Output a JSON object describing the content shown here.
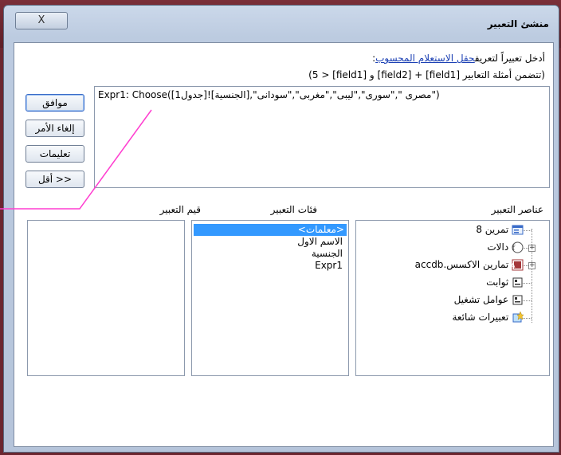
{
  "window": {
    "title": "منشئ التعبير",
    "close_label": "X"
  },
  "instructions": {
    "line1_prefix": "أدخل تعبيراً لتعريف",
    "line1_link": "حقل الاستعلام المحسوب",
    "line1_suffix": ":",
    "line2": "(تتضمن أمثلة التعابير [field1] + [field2] و [field1] < 5)"
  },
  "expression": {
    "value": "Expr1: Choose([جدول1]![الجنسية],\"مصرى \",\"سورى\",\"ليبى\",\"مغربى\",\"سودانى\")"
  },
  "buttons": {
    "ok": "موافق",
    "cancel": "إلغاء الأمر",
    "help": "تعليمات",
    "less": "<< أقل"
  },
  "sections": {
    "elements_label": "عناصر التعبير",
    "categories_label": "فئات التعبير",
    "values_label": "قيم التعبير"
  },
  "elements": [
    {
      "label": "تمرين 8",
      "icon": "form-icon"
    },
    {
      "label": "دالات",
      "icon": "function-icon"
    },
    {
      "label": "تمارين الاكسس.accdb",
      "icon": "database-icon"
    },
    {
      "label": "ثوابت",
      "icon": "folder-icon"
    },
    {
      "label": "عوامل تشغيل",
      "icon": "folder-icon"
    },
    {
      "label": "تعبيرات شائعة",
      "icon": "common-expression-icon"
    }
  ],
  "categories": [
    "<معلمات>",
    "الاسم الاول",
    "الجنسية",
    "Expr1"
  ],
  "selected_category": "<معلمات>",
  "colors": {
    "selection": "#3399ff",
    "annotation_line": "#ff3fd0",
    "link": "#1a3fb3"
  }
}
